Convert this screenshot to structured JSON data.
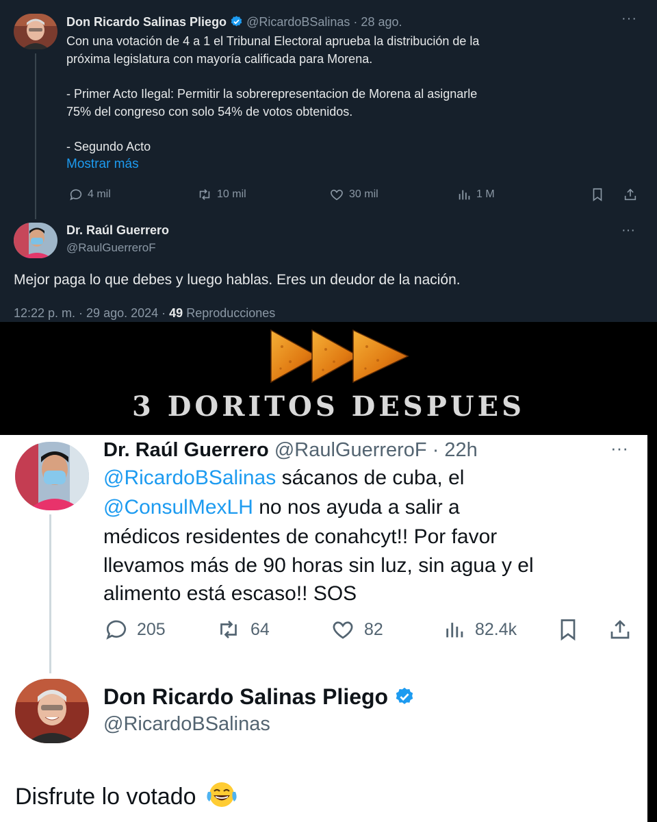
{
  "top_thread": {
    "original_tweet": {
      "author_name": "Don Ricardo Salinas Pliego",
      "handle_time": "@RicardoBSalinas · 28 ago.",
      "body_lines": [
        "Con una votación de 4 a 1 el Tribunal Electoral aprueba la distribución de la",
        "próxima legislatura con mayoría calificada para Morena.",
        "- Primer Acto Ilegal: Permitir la sobrerepresentacion de Morena al asignarle",
        "75% del congreso con solo 54% de votos obtenidos.",
        "- Segundo Acto"
      ],
      "show_more": "Mostrar más",
      "replies": "4 mil",
      "reposts": "10 mil",
      "likes": "30 mil",
      "views": "1 M",
      "more_glyph": "···"
    },
    "reply_tweet": {
      "author_name": "Dr. Raúl Guerrero",
      "handle": "@RaulGuerreroF",
      "text": "Mejor paga lo que debes y luego hablas. Eres un deudor de la nación.",
      "timestamp": "12:22 p. m. · 29 ago. 2024 · ",
      "view_count": "49",
      "view_label": " Reproducciones",
      "more_glyph": "···"
    }
  },
  "banner": {
    "text": "3 DORITOS DESPUES"
  },
  "bottom_thread": {
    "original_tweet": {
      "author_name": "Dr. Raúl Guerrero",
      "handle_time": "@RaulGuerreroF · 22h",
      "mention_1": "@RicardoBSalinas",
      "line_1_rest": " sácanos de cuba, el",
      "mention_2": "@ConsulMexLH",
      "line_2_rest": " no nos ayuda a salir a",
      "line_3": "médicos residentes de conahcyt!! Por favor",
      "line_4": "llevamos más de 90 horas sin luz, sin agua y el",
      "line_5": "alimento está escaso!! SOS",
      "replies": "205",
      "reposts": "64",
      "likes": "82",
      "views": "82.4k",
      "more_glyph": "···"
    },
    "reply_tweet": {
      "author_name": "Don Ricardo Salinas Pliego",
      "handle": "@RicardoBSalinas",
      "text": "Disfrute lo votado"
    }
  },
  "colors": {
    "dark_bg": "#16202b",
    "accent_blue": "#1d9bf0",
    "doritos_orange": "#e8871a"
  },
  "icons": [
    "comment-icon",
    "repost-icon",
    "like-icon",
    "views-icon",
    "bookmark-icon",
    "share-icon",
    "verified-badge-icon",
    "laughing-emoji-icon"
  ]
}
